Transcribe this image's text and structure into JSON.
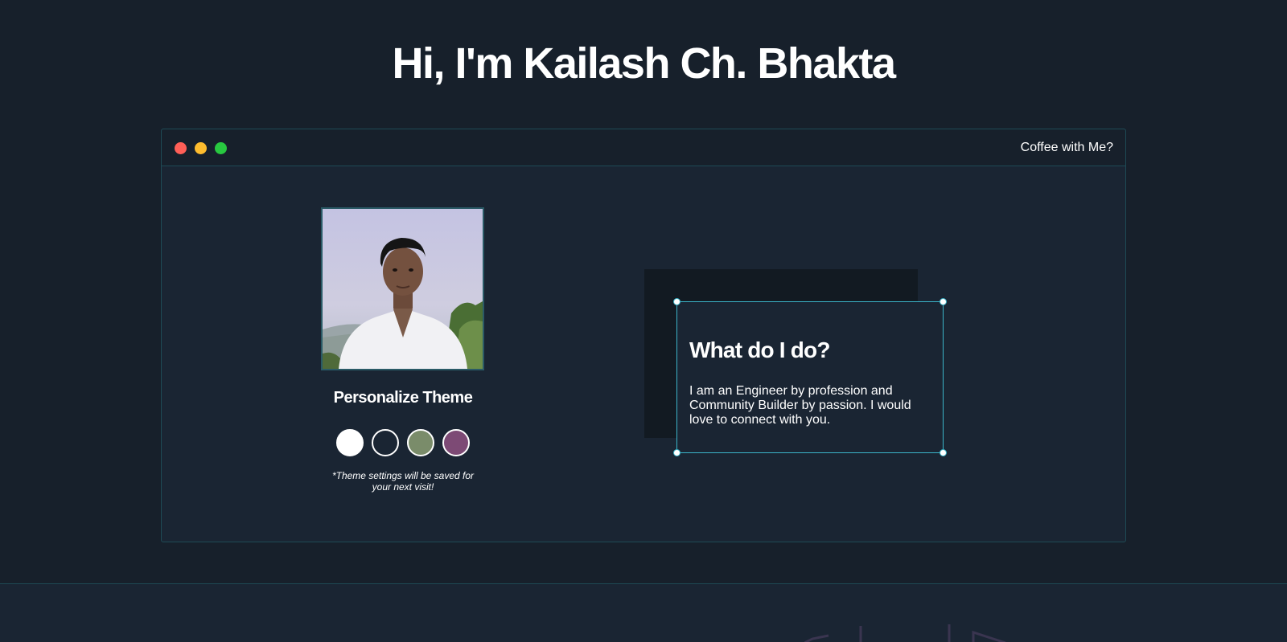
{
  "header": {
    "title": "Hi, I'm Kailash Ch. Bhakta"
  },
  "window": {
    "controls": [
      "close",
      "minimize",
      "maximize"
    ],
    "coffee_link": "Coffee with Me?"
  },
  "profile": {
    "photo_icon": "profile-photo"
  },
  "theme": {
    "title": "Personalize Theme",
    "swatches": [
      {
        "name": "white",
        "color": "#ffffff"
      },
      {
        "name": "dark-navy",
        "color": "#1a2533"
      },
      {
        "name": "sage-green",
        "color": "#7a8c6a"
      },
      {
        "name": "plum",
        "color": "#7d4a75"
      }
    ],
    "note": "*Theme settings will be saved for your next visit!"
  },
  "card": {
    "heading": "What do I do?",
    "body": "I am an Engineer by profession and Community Builder by passion. I would love to connect with you."
  },
  "colors": {
    "background": "#17202b",
    "panel": "#1a2533",
    "accent": "#3bb5c9",
    "window_border": "#1e4a55"
  }
}
